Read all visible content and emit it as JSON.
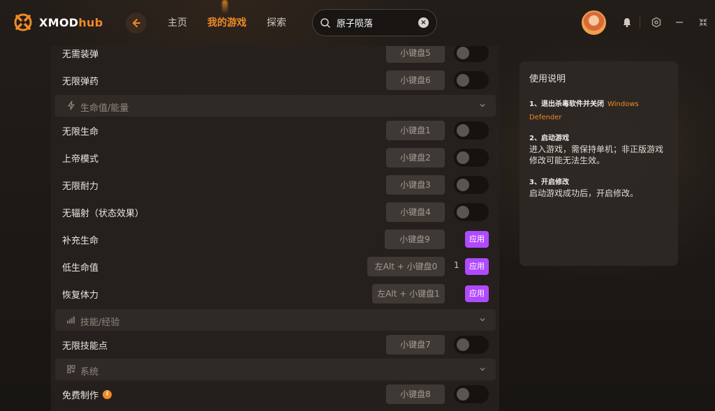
{
  "app": {
    "logo_text_main": "XMOD",
    "logo_text_accent": "hub"
  },
  "nav": {
    "items": [
      {
        "label": "主页"
      },
      {
        "label": "我的游戏"
      },
      {
        "label": "探索"
      }
    ],
    "active_index": 1
  },
  "search": {
    "value": "原子陨落",
    "clear_glyph": "×"
  },
  "rows": [
    {
      "label": "无需装弹",
      "hotkey": "小键盘5",
      "control": "toggle"
    },
    {
      "label": "无限弹药",
      "hotkey": "小键盘6",
      "control": "toggle"
    },
    {
      "label": "无限生命",
      "hotkey": "小键盘1",
      "control": "toggle"
    },
    {
      "label": "上帝模式",
      "hotkey": "小键盘2",
      "control": "toggle"
    },
    {
      "label": "无限耐力",
      "hotkey": "小键盘3",
      "control": "toggle"
    },
    {
      "label": "无辐射（状态效果）",
      "hotkey": "小键盘4",
      "control": "toggle"
    },
    {
      "label": "补充生命",
      "hotkey": "小键盘9",
      "control": "apply",
      "apply_label": "应用"
    },
    {
      "label": "低生命值",
      "hotkey": "左Alt + 小键盘0",
      "control": "apply",
      "value": "1",
      "apply_label": "应用"
    },
    {
      "label": "恢复体力",
      "hotkey": "左Alt + 小键盘1",
      "control": "apply",
      "apply_label": "应用"
    },
    {
      "label": "无限技能点",
      "hotkey": "小键盘7",
      "control": "toggle"
    },
    {
      "label": "免费制作",
      "hotkey": "小键盘8",
      "control": "toggle",
      "info": "i"
    }
  ],
  "sections": [
    {
      "label": "生命值/能量",
      "icon": "lightning-icon"
    },
    {
      "label": "技能/经验",
      "icon": "stats-icon"
    },
    {
      "label": "系统",
      "icon": "system-icon"
    }
  ],
  "help": {
    "title": "使用说明",
    "steps": [
      {
        "head": "1、退出杀毒软件并关闭",
        "link": "Windows Defender",
        "body": ""
      },
      {
        "head": "2、启动游戏",
        "body": "进入游戏，需保持单机；非正版游戏修改可能无法生效。"
      },
      {
        "head": "3、开启修改",
        "body": "启动游戏成功后，开启修改。"
      }
    ]
  },
  "colors": {
    "accent": "#f08a24",
    "apply": "#b04aff",
    "panel": "#26211e"
  }
}
